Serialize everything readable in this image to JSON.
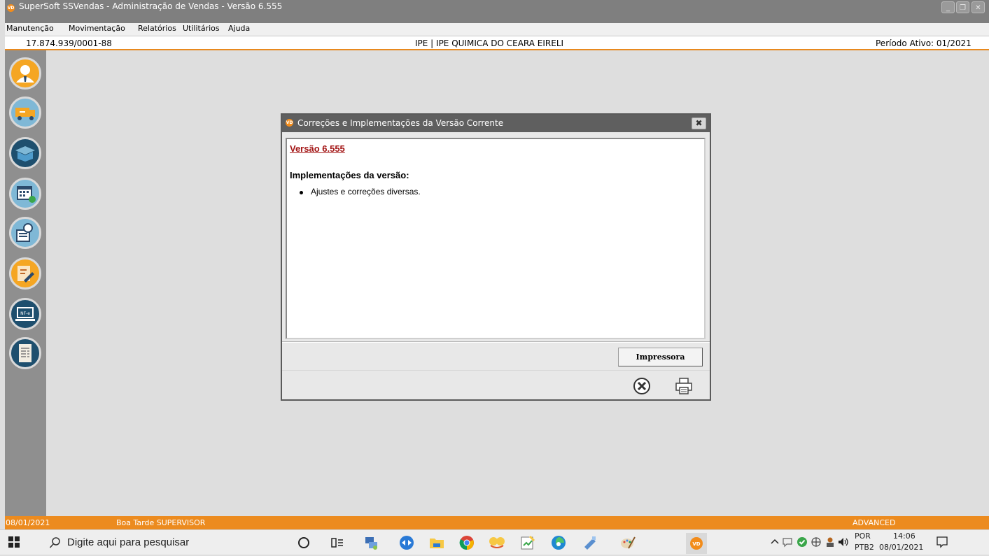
{
  "window": {
    "title": "SuperSoft SSVendas - Administração de Vendas - Versão 6.555",
    "app_icon": "VD",
    "controls": [
      "minimize-icon",
      "restore-icon",
      "close-icon"
    ]
  },
  "menu": {
    "items": [
      "Manutenção",
      "Movimentação",
      "Relatórios",
      "Utilitários",
      "Ajuda"
    ]
  },
  "infobar": {
    "cnpj": "17.874.939/0001-88",
    "company": "IPE | IPE QUIMICA DO CEARA EIRELI",
    "period": "Período Ativo: 01/2021"
  },
  "sidebar": {
    "buttons": [
      {
        "icon": "user-icon",
        "color": "#f5a623"
      },
      {
        "icon": "truck-icon",
        "color": "#7fb8d6"
      },
      {
        "icon": "box-icon",
        "color": "#1e4f6e"
      },
      {
        "icon": "calendar-icon",
        "color": "#7fb8d6"
      },
      {
        "icon": "money-receipt-icon",
        "color": "#7fb8d6"
      },
      {
        "icon": "notes-icon",
        "color": "#f5a623"
      },
      {
        "icon": "nfe-icon",
        "color": "#1e4f6e"
      },
      {
        "icon": "document-icon",
        "color": "#1e4f6e"
      }
    ]
  },
  "dialog": {
    "title": "Correções e Implementações da Versão Corrente",
    "version": "Versão 6.555",
    "heading": "Implementações da versão:",
    "items": [
      "Ajustes e correções diversas."
    ],
    "print_button": "Impressora",
    "footer_icons": [
      "cancel-icon",
      "printer-icon"
    ]
  },
  "statusbar": {
    "date": "08/01/2021",
    "greeting": "Boa Tarde SUPERVISOR",
    "edition": "ADVANCED"
  },
  "taskbar": {
    "search_placeholder": "Digite aqui para pesquisar",
    "language": "POR",
    "keyboard": "PTB2",
    "time": "14:06",
    "date": "08/01/2021"
  },
  "colors": {
    "accent": "#ec8b1f",
    "link": "#a31515",
    "sidebar": "#8f8f8f",
    "titlebar": "#7f7f7f"
  }
}
